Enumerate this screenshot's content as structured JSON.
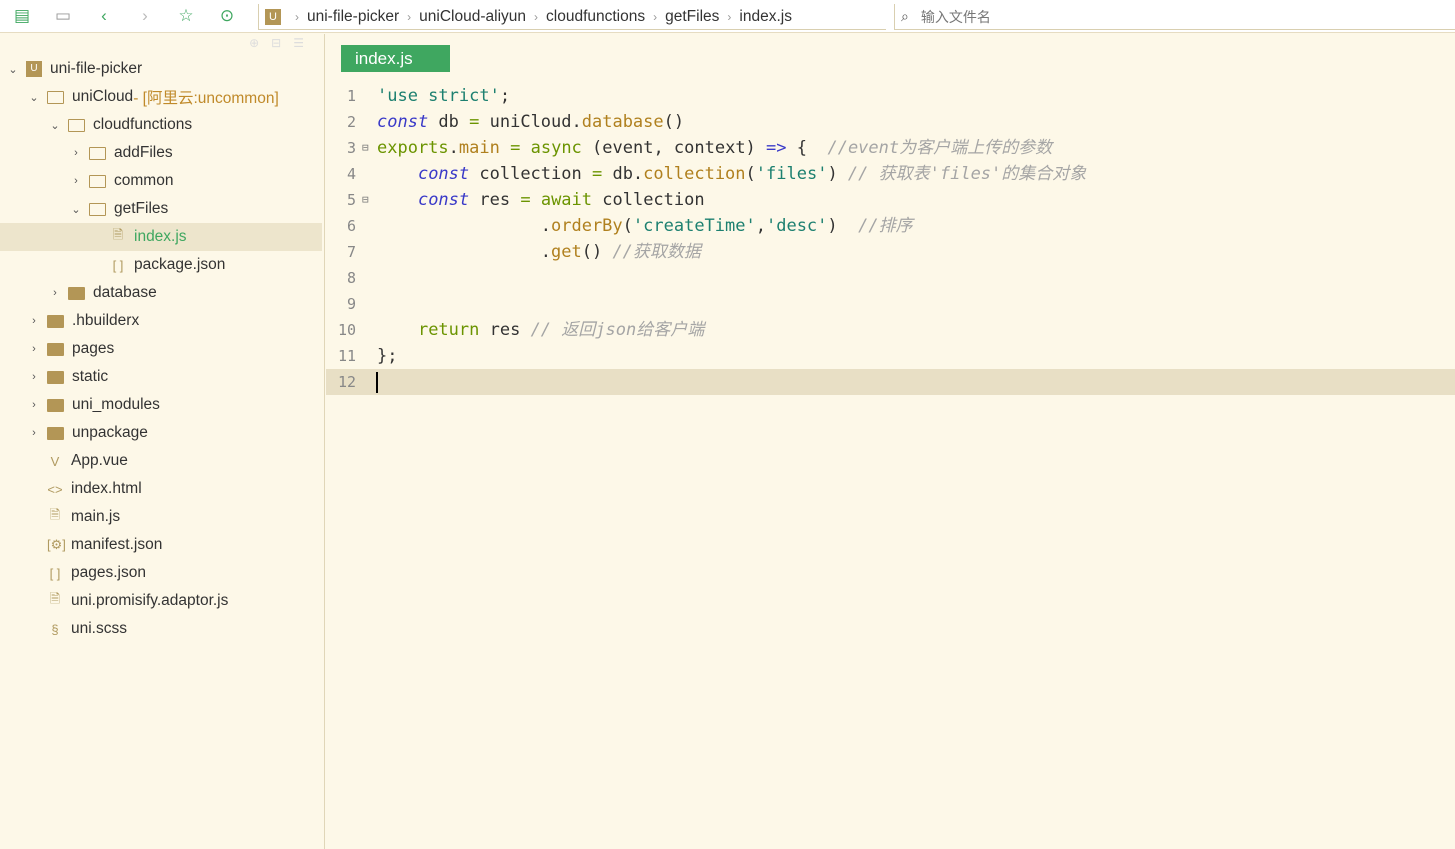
{
  "toolbar": {
    "icons": [
      "new-file-icon",
      "save-icon",
      "back-icon",
      "forward-icon",
      "star-icon",
      "run-icon"
    ]
  },
  "breadcrumb": [
    "uni-file-picker",
    "uniCloud-aliyun",
    "cloudfunctions",
    "getFiles",
    "index.js"
  ],
  "search": {
    "placeholder": "输入文件名"
  },
  "tree": [
    {
      "label": "uni-file-picker",
      "depth": 0,
      "type": "project",
      "arrow": "down"
    },
    {
      "label": "uniCloud",
      "note": " - [阿里云:uncommon]",
      "depth": 1,
      "type": "folder-open",
      "arrow": "down"
    },
    {
      "label": "cloudfunctions",
      "depth": 2,
      "type": "folder-open",
      "arrow": "down"
    },
    {
      "label": "addFiles",
      "depth": 3,
      "type": "folder-open",
      "arrow": "right"
    },
    {
      "label": "common",
      "depth": 3,
      "type": "folder-open",
      "arrow": "right"
    },
    {
      "label": "getFiles",
      "depth": 3,
      "type": "folder-open",
      "arrow": "down"
    },
    {
      "label": "index.js",
      "depth": 4,
      "type": "file-js",
      "active": true
    },
    {
      "label": "package.json",
      "depth": 4,
      "type": "file-json"
    },
    {
      "label": "database",
      "depth": 2,
      "type": "folder",
      "arrow": "right"
    },
    {
      "label": ".hbuilderx",
      "depth": 1,
      "type": "folder",
      "arrow": "right"
    },
    {
      "label": "pages",
      "depth": 1,
      "type": "folder",
      "arrow": "right"
    },
    {
      "label": "static",
      "depth": 1,
      "type": "folder",
      "arrow": "right"
    },
    {
      "label": "uni_modules",
      "depth": 1,
      "type": "folder",
      "arrow": "right"
    },
    {
      "label": "unpackage",
      "depth": 1,
      "type": "folder",
      "arrow": "right"
    },
    {
      "label": "App.vue",
      "depth": 1,
      "type": "file-vue"
    },
    {
      "label": "index.html",
      "depth": 1,
      "type": "file-html"
    },
    {
      "label": "main.js",
      "depth": 1,
      "type": "file-js"
    },
    {
      "label": "manifest.json",
      "depth": 1,
      "type": "file-manifest"
    },
    {
      "label": "pages.json",
      "depth": 1,
      "type": "file-json"
    },
    {
      "label": "uni.promisify.adaptor.js",
      "depth": 1,
      "type": "file-js"
    },
    {
      "label": "uni.scss",
      "depth": 1,
      "type": "file-scss"
    }
  ],
  "editor": {
    "tab": "index.js",
    "lines": [
      {
        "n": "1",
        "t": [
          [
            "str",
            "'use strict'"
          ],
          [
            "pl",
            ";"
          ]
        ]
      },
      {
        "n": "2",
        "t": [
          [
            "kw",
            "const"
          ],
          [
            "pl",
            " db "
          ],
          [
            "op",
            "="
          ],
          [
            "pl",
            " uniCloud."
          ],
          [
            "fn",
            "database"
          ],
          [
            "pl",
            "()"
          ]
        ]
      },
      {
        "n": "3",
        "fold": true,
        "t": [
          [
            "op",
            "exports"
          ],
          [
            "pl",
            "."
          ],
          [
            "fn",
            "main"
          ],
          [
            "pl",
            " "
          ],
          [
            "op",
            "="
          ],
          [
            "pl",
            " "
          ],
          [
            "op",
            "async"
          ],
          [
            "pl",
            " (event, context) "
          ],
          [
            "kw",
            "=>"
          ],
          [
            "pl",
            " {  "
          ],
          [
            "cm",
            "//event为客户端上传的参数"
          ]
        ]
      },
      {
        "n": "4",
        "t": [
          [
            "pl",
            "    "
          ],
          [
            "kw",
            "const"
          ],
          [
            "pl",
            " collection "
          ],
          [
            "op",
            "="
          ],
          [
            "pl",
            " db."
          ],
          [
            "fn",
            "collection"
          ],
          [
            "pl",
            "("
          ],
          [
            "str",
            "'files'"
          ],
          [
            "pl",
            ") "
          ],
          [
            "cm",
            "// 获取表'files'的集合对象"
          ]
        ]
      },
      {
        "n": "5",
        "fold": true,
        "t": [
          [
            "pl",
            "    "
          ],
          [
            "kw",
            "const"
          ],
          [
            "pl",
            " res "
          ],
          [
            "op",
            "="
          ],
          [
            "pl",
            " "
          ],
          [
            "op",
            "await"
          ],
          [
            "pl",
            " collection"
          ]
        ]
      },
      {
        "n": "6",
        "t": [
          [
            "pl",
            "                ."
          ],
          [
            "fn",
            "orderBy"
          ],
          [
            "pl",
            "("
          ],
          [
            "str",
            "'createTime'"
          ],
          [
            "pl",
            ","
          ],
          [
            "str",
            "'desc'"
          ],
          [
            "pl",
            ")  "
          ],
          [
            "cm",
            "//排序"
          ]
        ]
      },
      {
        "n": "7",
        "t": [
          [
            "pl",
            "                ."
          ],
          [
            "fn",
            "get"
          ],
          [
            "pl",
            "() "
          ],
          [
            "cm",
            "//获取数据"
          ]
        ]
      },
      {
        "n": "8",
        "t": []
      },
      {
        "n": "9",
        "t": []
      },
      {
        "n": "10",
        "t": [
          [
            "pl",
            "    "
          ],
          [
            "op",
            "return"
          ],
          [
            "pl",
            " res "
          ],
          [
            "cm",
            "// 返回json给客户端"
          ]
        ]
      },
      {
        "n": "11",
        "t": [
          [
            "pl",
            "};"
          ]
        ]
      },
      {
        "n": "12",
        "t": [],
        "current": true
      }
    ]
  }
}
